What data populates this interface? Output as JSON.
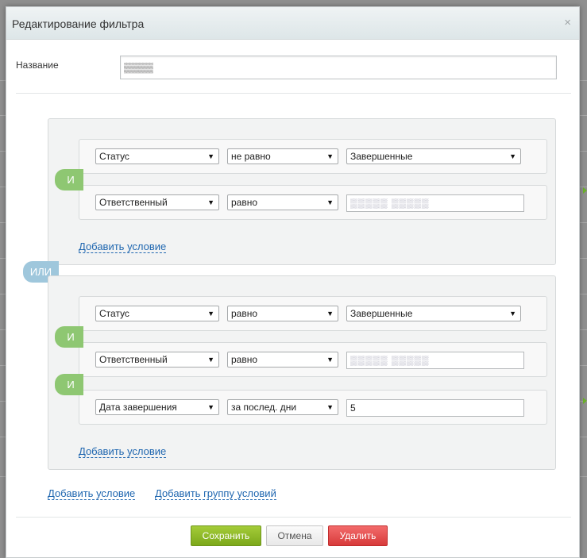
{
  "dialog": {
    "title": "Редактирование фильтра",
    "close": "×"
  },
  "name_field": {
    "label": "Название",
    "value": "▒▒▒▒"
  },
  "groups": [
    {
      "conditions": [
        {
          "field": "Статус",
          "operator": "не равно",
          "value": "Завершенные",
          "value_kind": "select"
        },
        {
          "field": "Ответственный",
          "operator": "равно",
          "value": "▒▒▒▒▒ ▒▒▒▒▒",
          "value_kind": "text"
        }
      ],
      "joiners": [
        "И"
      ],
      "add_condition": "Добавить условие"
    },
    {
      "conditions": [
        {
          "field": "Статус",
          "operator": "равно",
          "value": "Завершенные",
          "value_kind": "select"
        },
        {
          "field": "Ответственный",
          "operator": "равно",
          "value": "▒▒▒▒▒ ▒▒▒▒▒",
          "value_kind": "text"
        },
        {
          "field": "Дата завершения",
          "operator": "за послед. дни",
          "value": "5",
          "value_kind": "text"
        }
      ],
      "joiners": [
        "И",
        "И"
      ],
      "add_condition": "Добавить условие"
    }
  ],
  "group_joiner": "ИЛИ",
  "footer_links": {
    "add_condition": "Добавить условие",
    "add_group": "Добавить группу условий"
  },
  "buttons": {
    "save": "Сохранить",
    "cancel": "Отмена",
    "delete": "Удалить"
  },
  "icons": {
    "dropdown": "▼"
  },
  "colors": {
    "and_badge": "#8ec772",
    "or_badge": "#9fc7dc",
    "link": "#2067b0",
    "save": "#8db528",
    "delete": "#e04848"
  }
}
